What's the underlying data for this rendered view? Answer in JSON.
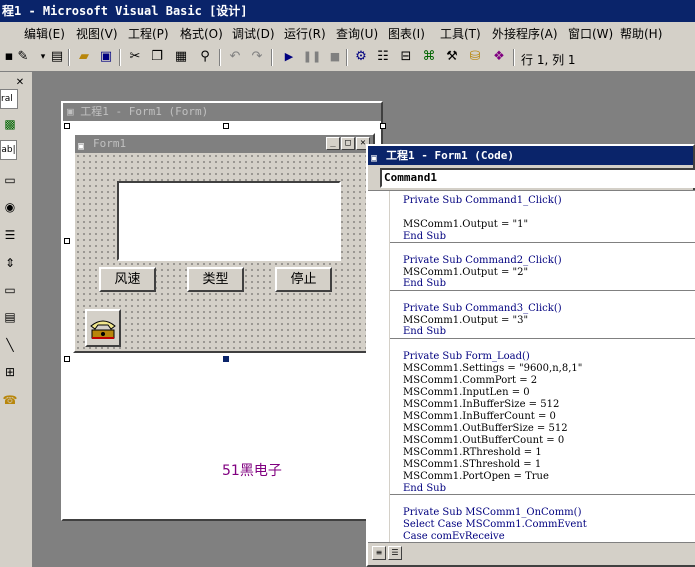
{
  "window": {
    "title": "程1 - Microsoft Visual Basic [设计]"
  },
  "menu": [
    "编辑(E)",
    "视图(V)",
    "工程(P)",
    "格式(O)",
    "调试(D)",
    "运行(R)",
    "查询(U)",
    "图表(I)",
    "工具(T)",
    "外接程序(A)",
    "窗口(W)",
    "帮助(H)"
  ],
  "toolbar": {
    "position_text": "行 1, 列 1",
    "icons": [
      "add-form-icon",
      "menu-editor-icon",
      "open-icon",
      "save-icon",
      "cut-icon",
      "copy-icon",
      "paste-icon",
      "find-icon",
      "undo-icon",
      "redo-icon",
      "start-icon",
      "break-icon",
      "end-icon",
      "project-explorer-icon",
      "properties-icon",
      "form-layout-icon",
      "object-browser-icon",
      "toolbox-icon",
      "data-view-icon",
      "component-manager-icon"
    ]
  },
  "toolbox": {
    "close_glyph": "✕",
    "general_label": "ral",
    "textbox_label": "ab|"
  },
  "form_designer": {
    "title": "工程1 - Form1 (Form)",
    "form": {
      "title": "Form1",
      "buttons": [
        "风速",
        "类型",
        "停止"
      ]
    }
  },
  "code_window": {
    "title": "工程1 - Form1 (Code)",
    "object": "Command1",
    "procedures": [
      [
        "Private Sub Command1_Click()",
        "",
        "MSComm1.Output = \"1\"",
        "End Sub"
      ],
      [
        "Private Sub Command2_Click()",
        "MSComm1.Output = \"2\"",
        "End Sub"
      ],
      [
        "Private Sub Command3_Click()",
        "MSComm1.Output = \"3\"",
        "End Sub"
      ],
      [
        "Private Sub Form_Load()",
        "MSComm1.Settings = \"9600,n,8,1\"",
        "MSComm1.CommPort = 2",
        "MSComm1.InputLen = 0",
        "MSComm1.InBufferSize = 512",
        "MSComm1.InBufferCount = 0",
        "MSComm1.OutBufferSize = 512",
        "MSComm1.OutBufferCount = 0",
        "MSComm1.RThreshold = 1",
        "MSComm1.SThreshold = 1",
        "MSComm1.PortOpen = True",
        "End Sub"
      ],
      [
        "Private Sub MSComm1_OnComm()",
        "Select Case MSComm1.CommEvent",
        "Case comEvReceive"
      ]
    ]
  },
  "watermark": "51黑电子"
}
